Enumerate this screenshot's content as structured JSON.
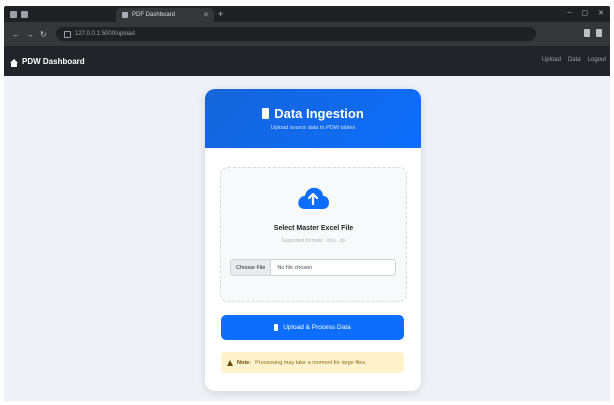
{
  "browser": {
    "tab_title": "PDF Dashboard",
    "url": "127.0.0.1:5000/upload"
  },
  "navbar": {
    "brand": "PDW Dashboard",
    "links": [
      "Upload",
      "Data",
      "Logout"
    ]
  },
  "card": {
    "title": "Data Ingestion",
    "subtitle": "Upload source data to PDW tables",
    "dropzone": {
      "title": "Select Master Excel File",
      "hint": "Supported formats: .xlsx, .xls",
      "choose_label": "Choose File",
      "file_status": "No file chosen"
    },
    "upload_button": "Upload & Process Data",
    "note": {
      "label": "Note:",
      "text": "Processing may take a moment for large files."
    }
  },
  "colors": {
    "primary": "#0d6efd",
    "navbar": "#212529",
    "page_bg": "#eef2f6",
    "note_bg": "#fff3cd"
  }
}
